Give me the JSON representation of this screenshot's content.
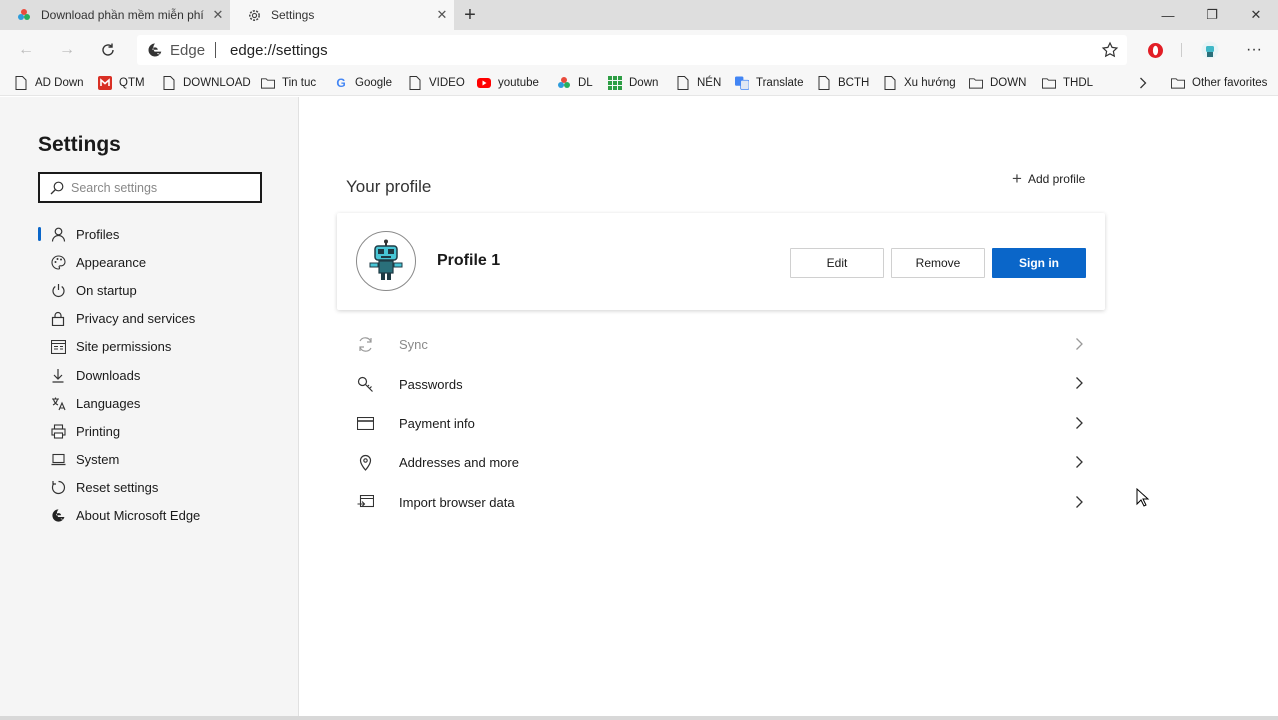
{
  "tabs": [
    {
      "title": "Download phần mềm miễn phí và",
      "icon": "colorful-logo-icon",
      "active": false
    },
    {
      "title": "Settings",
      "icon": "gear-icon",
      "active": true
    }
  ],
  "addressbar": {
    "brand": "Edge",
    "url": "edge://settings"
  },
  "favorites": [
    {
      "label": "AD Down",
      "icon": "page-icon"
    },
    {
      "label": "QTM",
      "icon": "gmail-icon"
    },
    {
      "label": "DOWNLOAD",
      "icon": "page-icon"
    },
    {
      "label": "Tin tuc",
      "icon": "folder-icon"
    },
    {
      "label": "Google",
      "icon": "google-icon"
    },
    {
      "label": "VIDEO",
      "icon": "page-icon"
    },
    {
      "label": "youtube",
      "icon": "youtube-icon"
    },
    {
      "label": "DL",
      "icon": "colorful-logo-icon"
    },
    {
      "label": "Down",
      "icon": "grid-icon"
    },
    {
      "label": "NÉN",
      "icon": "page-icon"
    },
    {
      "label": "Translate",
      "icon": "translate-icon"
    },
    {
      "label": "BCTH",
      "icon": "page-icon"
    },
    {
      "label": "Xu hướng",
      "icon": "page-icon"
    },
    {
      "label": "DOWN",
      "icon": "folder-icon"
    },
    {
      "label": "THDL",
      "icon": "folder-icon"
    }
  ],
  "other_favorites": "Other favorites",
  "sidebar": {
    "title": "Settings",
    "search_placeholder": "Search settings",
    "items": [
      {
        "label": "Profiles",
        "icon": "person-icon",
        "selected": true
      },
      {
        "label": "Appearance",
        "icon": "palette-icon"
      },
      {
        "label": "On startup",
        "icon": "power-icon"
      },
      {
        "label": "Privacy and services",
        "icon": "lock-icon"
      },
      {
        "label": "Site permissions",
        "icon": "site-permissions-icon"
      },
      {
        "label": "Downloads",
        "icon": "download-icon"
      },
      {
        "label": "Languages",
        "icon": "languages-icon"
      },
      {
        "label": "Printing",
        "icon": "printer-icon"
      },
      {
        "label": "System",
        "icon": "laptop-icon"
      },
      {
        "label": "Reset settings",
        "icon": "reset-icon"
      },
      {
        "label": "About Microsoft Edge",
        "icon": "edge-logo-icon"
      }
    ]
  },
  "main": {
    "section_title": "Your profile",
    "add_profile": "Add profile",
    "profile_name": "Profile 1",
    "edit_label": "Edit",
    "remove_label": "Remove",
    "signin_label": "Sign in",
    "rows": [
      {
        "label": "Sync",
        "icon": "sync-icon",
        "disabled": true
      },
      {
        "label": "Passwords",
        "icon": "key-icon"
      },
      {
        "label": "Payment info",
        "icon": "card-icon"
      },
      {
        "label": "Addresses and more",
        "icon": "location-pin-icon"
      },
      {
        "label": "Import browser data",
        "icon": "import-icon"
      }
    ]
  },
  "colors": {
    "accent": "#0a66c9",
    "sidebar_bg": "#f5f5f5",
    "tabstrip_bg": "#dedede"
  }
}
